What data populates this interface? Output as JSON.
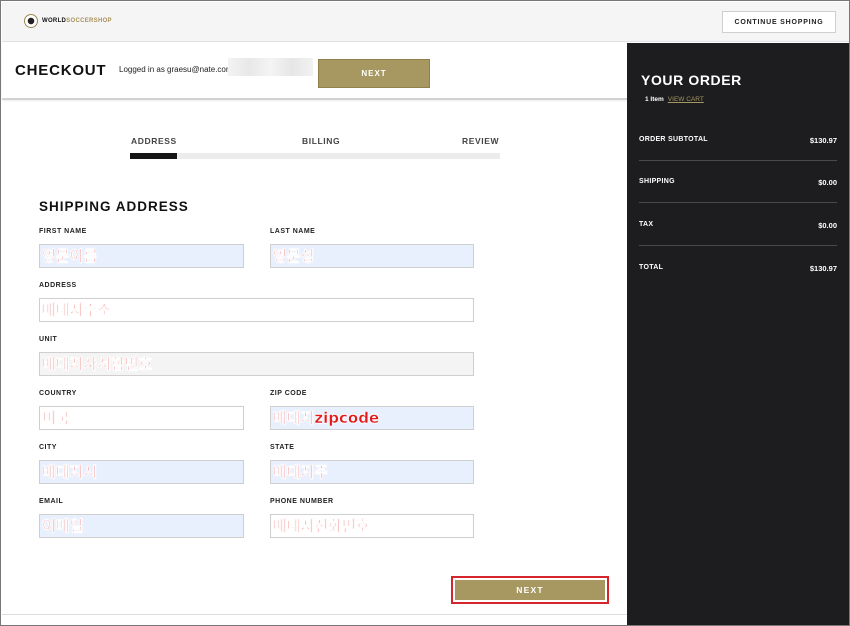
{
  "header": {
    "logo_word1": "WORLD",
    "logo_word2": "SOCCERSHOP",
    "continue_label": "CONTINUE SHOPPING"
  },
  "checkout": {
    "title": "CHECKOUT",
    "logged_in": "Logged in as graesu@nate.com",
    "next_label": "NEXT"
  },
  "steps": [
    {
      "label": "ADDRESS"
    },
    {
      "label": "BILLING"
    },
    {
      "label": "REVIEW"
    }
  ],
  "form": {
    "section_title": "SHIPPING ADDRESS",
    "first_name": {
      "label": "FIRST NAME",
      "value": "영문이름"
    },
    "last_name": {
      "label": "LAST NAME",
      "value": "영문성"
    },
    "address": {
      "label": "ADDRESS",
      "value": "배대지주소"
    },
    "unit": {
      "label": "UNIT",
      "value": "배대지사서함번호"
    },
    "country": {
      "label": "COUNTRY",
      "value": "미국"
    },
    "zip": {
      "label": "ZIP CODE",
      "value": "배대지zipcode"
    },
    "city": {
      "label": "CITY",
      "value": "배대지시"
    },
    "state": {
      "label": "STATE",
      "value": "배대지주"
    },
    "email": {
      "label": "EMAIL",
      "value": "이메일"
    },
    "phone": {
      "label": "PHONE NUMBER",
      "value": "배대지전화번호"
    },
    "next_label": "NEXT"
  },
  "order": {
    "title": "YOUR ORDER",
    "item_count": "1 Item",
    "view_cart": "VIEW CART",
    "rows": [
      {
        "label": "ORDER SUBTOTAL",
        "value": "$130.97"
      },
      {
        "label": "SHIPPING",
        "value": "$0.00"
      },
      {
        "label": "TAX",
        "value": "$0.00"
      },
      {
        "label": "TOTAL",
        "value": "$130.97"
      }
    ]
  },
  "colors": {
    "accent_gold": "#a79760",
    "sidebar_bg": "#1d1d1f",
    "highlight_red": "#e21a1a"
  }
}
